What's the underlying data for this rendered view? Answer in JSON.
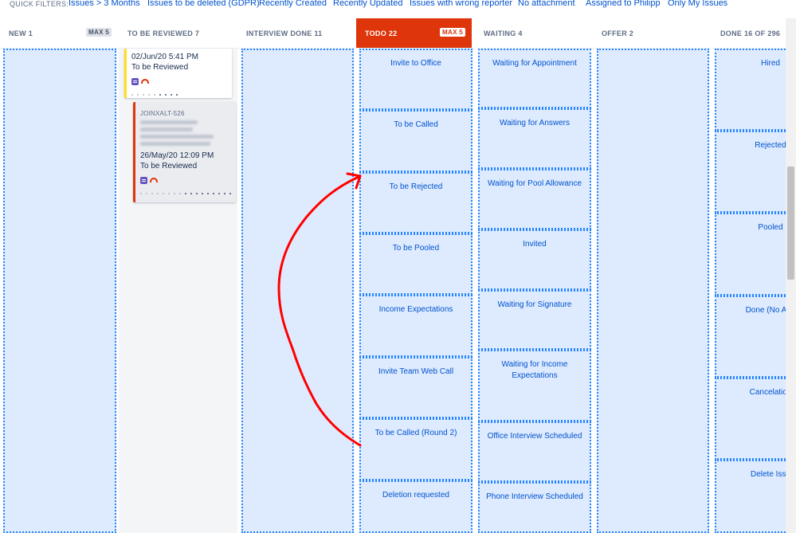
{
  "quick_filters": {
    "label": "QUICK FILTERS:",
    "items": [
      "Issues > 3 Months",
      "Issues to be deleted (GDPR)",
      "Recently Created",
      "Recently Updated",
      "Issues with wrong reporter",
      "No attachment",
      "Assigned to Philipp",
      "Only My Issues"
    ]
  },
  "columns": [
    {
      "title": "NEW 1",
      "max": "MAX 5"
    },
    {
      "title": "TO BE REVIEWED 7"
    },
    {
      "title": "INTERVIEW DONE 11"
    },
    {
      "title": "TODO 22",
      "max": "MAX 5",
      "over_limit": true
    },
    {
      "title": "WAITING 4"
    },
    {
      "title": "OFFER 2"
    },
    {
      "title": "DONE 16 OF 296"
    }
  ],
  "cards": [
    {
      "date": "02/Jun/20 5:41 PM",
      "status": "To be Reviewed",
      "type_icon": "story-icon",
      "priority_icon": "priority-high-icon"
    },
    {
      "key": "JOINXALT-526",
      "date": "26/May/20 12:09 PM",
      "status": "To be Reviewed",
      "type_icon": "story-icon",
      "priority_icon": "priority-high-icon"
    }
  ],
  "todo_statuses": [
    "Invite to Office",
    "To be Called",
    "To be Rejected",
    "To be Pooled",
    "Income Expectations",
    "Invite Team Web Call",
    "To be Called (Round 2)",
    "Deletion requested"
  ],
  "waiting_statuses": [
    "Waiting for Appointment",
    "Waiting for Answers",
    "Waiting for Pool Allowance",
    "Invited",
    "Waiting for Signature",
    "Waiting for Income Expectations",
    "Office Interview Scheduled",
    "Phone Interview Scheduled"
  ],
  "done_statuses": [
    "Hired",
    "Rejected",
    "Pooled",
    "Done (No App",
    "Cancelation",
    "Delete Issu"
  ],
  "colors": {
    "accent": "#0052cc",
    "dropzone": "#deebff",
    "dotted_border": "#2684ff",
    "over_limit": "#de350b",
    "annotation": "#ff0000"
  }
}
